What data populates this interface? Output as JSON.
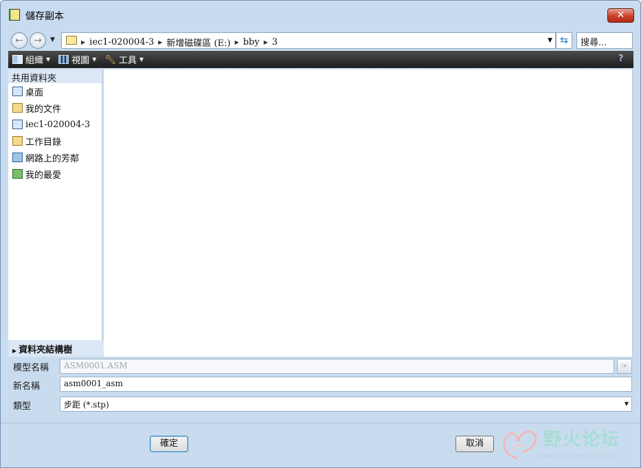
{
  "window": {
    "title": "儲存副本",
    "close_label": "✕"
  },
  "address_bar": {
    "crumbs": [
      "iec1-020004-3",
      "新增磁碟區 (E:)",
      "bby",
      "3"
    ],
    "search_placeholder": "搜尋..."
  },
  "toolbar": {
    "organize": "組織",
    "view": "視圖",
    "tools": "工具"
  },
  "nav_pane": {
    "header": "共用資料夾",
    "items": [
      {
        "label": "桌面",
        "icon": "desktop-icon"
      },
      {
        "label": "我的文件",
        "icon": "my-documents-icon"
      },
      {
        "label": "iec1-020004-3",
        "icon": "computer-icon"
      },
      {
        "label": "工作目錄",
        "icon": "working-directory-icon"
      },
      {
        "label": "網路上的芳鄰",
        "icon": "network-icon"
      },
      {
        "label": "我的最愛",
        "icon": "favorites-icon"
      }
    ],
    "folder_tree": "資料夾結構樹"
  },
  "form": {
    "model_name_label": "模型名稱",
    "model_name_value": "ASM0001.ASM",
    "new_name_label": "新名稱",
    "new_name_value": "asm0001_asm",
    "type_label": "類型",
    "type_value": "步距 (*.stp)"
  },
  "buttons": {
    "ok": "確定",
    "cancel": "取消"
  },
  "watermark": {
    "title": "野火论坛",
    "url": "www.proewildfire.cn"
  }
}
